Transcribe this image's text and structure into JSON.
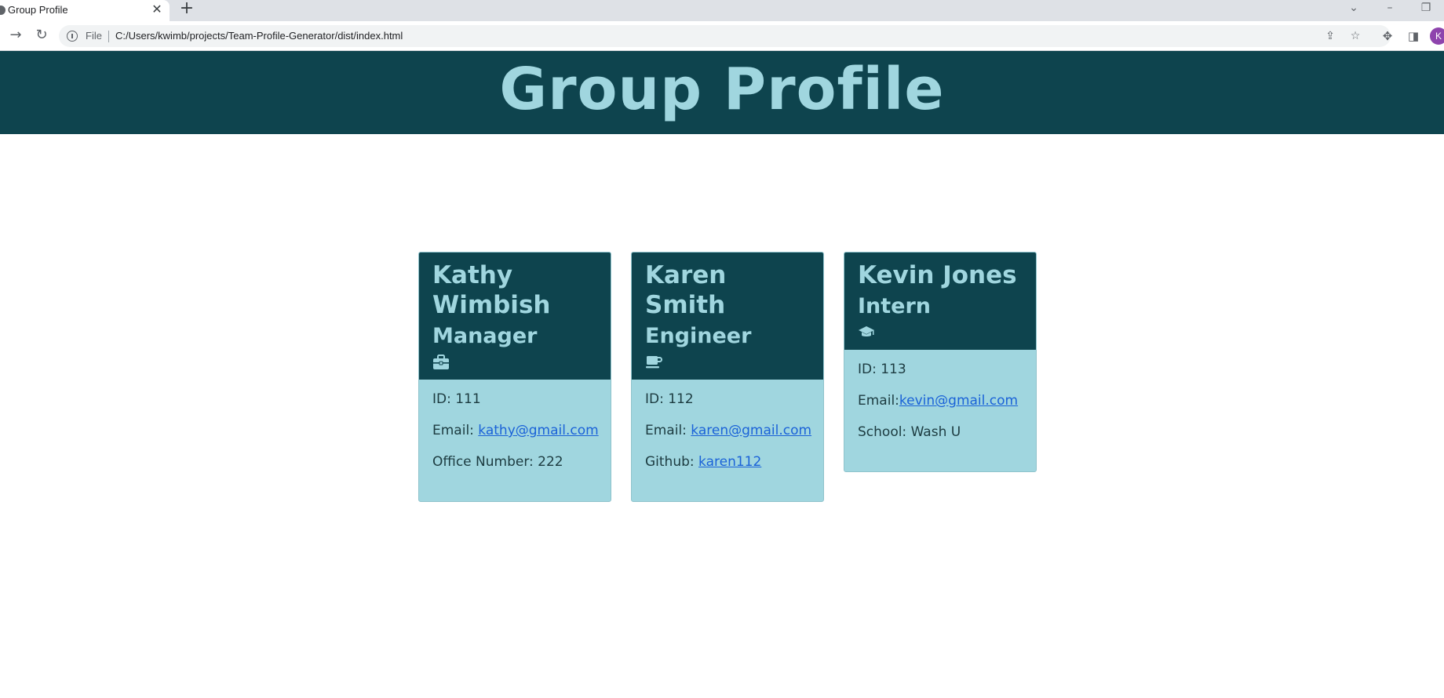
{
  "browser": {
    "tab_title": "Group Profile",
    "tab_close": "✕",
    "new_tab": "+",
    "file_label": "File",
    "url": "C:/Users/kwimb/projects/Team-Profile-Generator/dist/index.html",
    "avatar_initial": "K"
  },
  "page": {
    "title": "Group Profile"
  },
  "team": [
    {
      "name": "Kathy Wimbish",
      "role": "Manager",
      "icon": "briefcase-icon",
      "id_text": "ID: 111",
      "email_label": "Email: ",
      "email": "kathy@gmail.com",
      "extra_label": "Office Number: 222",
      "extra_link": ""
    },
    {
      "name": "Karen Smith",
      "role": "Engineer",
      "icon": "mug-icon",
      "id_text": "ID: 112",
      "email_label": "Email: ",
      "email": "karen@gmail.com",
      "extra_label": "Github: ",
      "extra_link": "karen112"
    },
    {
      "name": "Kevin Jones",
      "role": "Intern",
      "icon": "graduation-cap-icon",
      "id_text": "ID: 113",
      "email_label": "Email:",
      "email": "kevin@gmail.com",
      "extra_label": "School: Wash U",
      "extra_link": ""
    }
  ],
  "colors": {
    "header_bg": "#0e444e",
    "accent_text": "#a0d6df",
    "card_body_bg": "#a0d6df",
    "link": "#1a62d8"
  }
}
